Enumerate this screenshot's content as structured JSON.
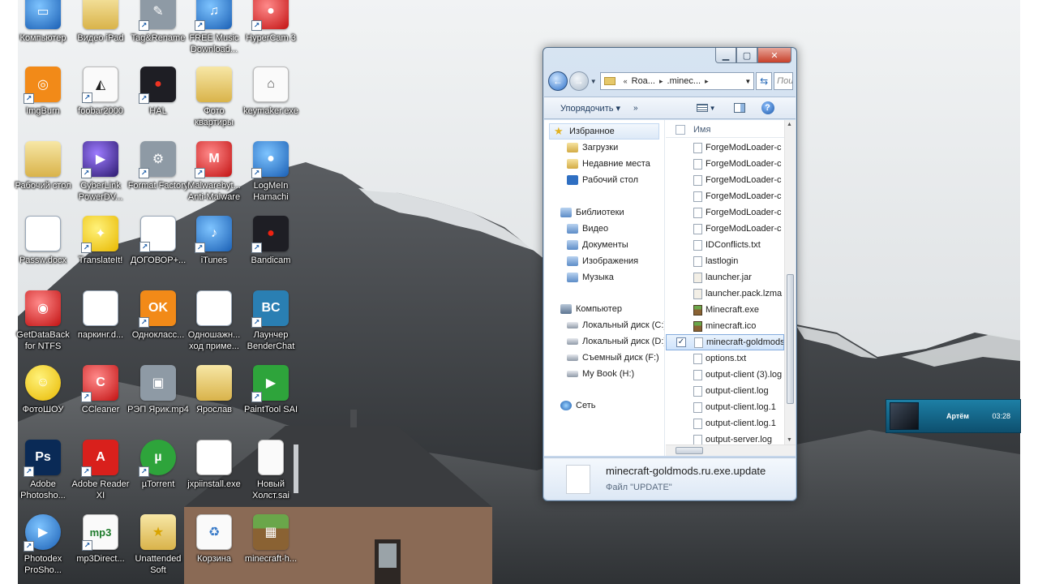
{
  "desktop_icons": [
    {
      "label": "Компьютер",
      "icon": "computer-icon"
    },
    {
      "label": "Видео iPad",
      "icon": "folder-icon"
    },
    {
      "label": "Tag&Rename",
      "icon": "tag-rename-icon"
    },
    {
      "label": "FREE Music Download...",
      "icon": "music-download-icon"
    },
    {
      "label": "HyperCam 3",
      "icon": "hypercam-icon"
    },
    {
      "label": "ImgBurn",
      "icon": "imgburn-icon"
    },
    {
      "label": "foobar2000",
      "icon": "foobar-icon"
    },
    {
      "label": "HAL",
      "icon": "hal-icon"
    },
    {
      "label": "Фото квартиры",
      "icon": "folder-icon"
    },
    {
      "label": "keymaker.exe",
      "icon": "keymaker-icon"
    },
    {
      "label": "Рабочий стол",
      "icon": "folder-icon"
    },
    {
      "label": "CyberLink PowerDV...",
      "icon": "powerdvd-icon"
    },
    {
      "label": "Format Factory",
      "icon": "format-factory-icon"
    },
    {
      "label": "Malwarebyt... Anti-Malware",
      "icon": "malwarebytes-icon"
    },
    {
      "label": "LogMeIn Hamachi",
      "icon": "hamachi-icon"
    },
    {
      "label": "Passw.docx",
      "icon": "word-doc-icon"
    },
    {
      "label": "TranslateIt!",
      "icon": "translateit-icon"
    },
    {
      "label": "ДОГОВОР+...",
      "icon": "word-doc-icon"
    },
    {
      "label": "iTunes",
      "icon": "itunes-icon"
    },
    {
      "label": "Bandicam",
      "icon": "bandicam-icon"
    },
    {
      "label": "GetDataBack for NTFS",
      "icon": "lifebuoy-icon"
    },
    {
      "label": "паркинг.d...",
      "icon": "word-doc-icon"
    },
    {
      "label": "Однокласс...",
      "icon": "odnoklassniki-icon"
    },
    {
      "label": "Одношажн... ход приме...",
      "icon": "word-doc-icon"
    },
    {
      "label": "Лаунчер BenderChat",
      "icon": "benderchat-icon"
    },
    {
      "label": "ФотоШОУ",
      "icon": "smiley-icon"
    },
    {
      "label": "CCleaner",
      "icon": "ccleaner-icon"
    },
    {
      "label": "РЭП Ярик.mp4",
      "icon": "video-file-icon"
    },
    {
      "label": "Ярослав",
      "icon": "folder-icon"
    },
    {
      "label": "PaintTool SAI",
      "icon": "play-icon"
    },
    {
      "label": "Adobe Photosho...",
      "icon": "photoshop-icon"
    },
    {
      "label": "Adobe Reader XI",
      "icon": "adobe-reader-icon"
    },
    {
      "label": "µTorrent",
      "icon": "utorrent-icon"
    },
    {
      "label": "jxpiinstall.exe",
      "icon": "java-icon"
    },
    {
      "label": "Новый Холст.sai",
      "icon": "blank-file-icon"
    },
    {
      "label": "Photodex ProSho...",
      "icon": "proshow-icon"
    },
    {
      "label": "mp3Direct...",
      "icon": "mp3-icon"
    },
    {
      "label": "Unattended Soft",
      "icon": "folder-star-icon"
    },
    {
      "label": "Корзина",
      "icon": "recycle-bin-icon"
    },
    {
      "label": "minecraft-h...",
      "icon": "minecraft-icon"
    }
  ],
  "explorer": {
    "address": {
      "part1": "Roa...",
      "part2": ".minec..."
    },
    "search_placeholder": "Пои",
    "toolbar": {
      "organize": "Упорядочить ▾",
      "more": "»"
    },
    "nav": {
      "favorites": {
        "label": "Избранное",
        "items": [
          "Загрузки",
          "Недавние места",
          "Рабочий стол"
        ]
      },
      "libraries": {
        "label": "Библиотеки",
        "items": [
          "Видео",
          "Документы",
          "Изображения",
          "Музыка"
        ]
      },
      "computer": {
        "label": "Компьютер",
        "items": [
          "Локальный диск (C:)",
          "Локальный диск (D:)",
          "Съемный диск (F:)",
          "My Book (H:)"
        ]
      },
      "network": {
        "label": "Сеть"
      }
    },
    "column_header": "Имя",
    "files": [
      "ForgeModLoader-c",
      "ForgeModLoader-c",
      "ForgeModLoader-c",
      "ForgeModLoader-c",
      "ForgeModLoader-c",
      "ForgeModLoader-c",
      "IDConflicts.txt",
      "lastlogin",
      "launcher.jar",
      "launcher.pack.lzma",
      "Minecraft.exe",
      "minecraft.ico",
      "minecraft-goldmods",
      "options.txt",
      "output-client (3).log",
      "output-client.log",
      "output-client.log.1",
      "output-client.log.1",
      "output-server.log"
    ],
    "selected_file_index": 12,
    "details": {
      "name": "minecraft-goldmods.ru.exe.update",
      "type": "Файл \"UPDATE\""
    }
  },
  "notification": {
    "name": "Артём",
    "time": "03:28"
  },
  "colors": {
    "accent": "#2c70c9",
    "selection": "#cfe3fb",
    "notify_bg": "#1d7fa5"
  }
}
